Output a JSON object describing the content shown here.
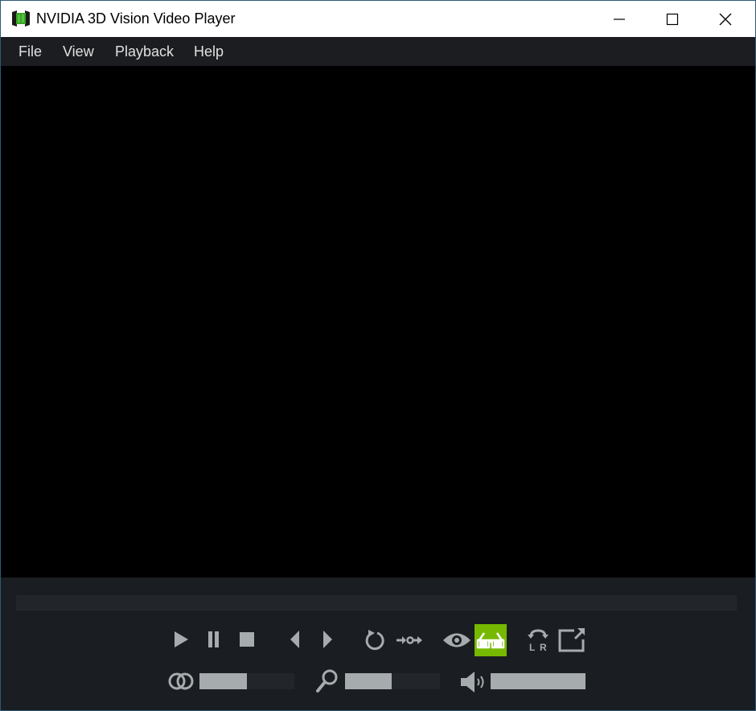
{
  "window": {
    "title": "NVIDIA 3D Vision Video Player",
    "icon": "nvidia-app-icon",
    "controls": [
      "minimize",
      "maximize",
      "close"
    ]
  },
  "menu": {
    "items": [
      {
        "label": "File"
      },
      {
        "label": "View"
      },
      {
        "label": "Playback"
      },
      {
        "label": "Help"
      }
    ]
  },
  "player": {
    "seek_progress": 0,
    "buttons": [
      {
        "name": "play",
        "icon": "play-icon"
      },
      {
        "name": "pause",
        "icon": "pause-icon"
      },
      {
        "name": "stop",
        "icon": "stop-icon"
      },
      {
        "name": "previous",
        "icon": "step-back-icon"
      },
      {
        "name": "next",
        "icon": "step-forward-icon"
      },
      {
        "name": "repeat",
        "icon": "repeat-icon"
      },
      {
        "name": "ab-loop",
        "icon": "ab-loop-icon"
      },
      {
        "name": "2d-view",
        "icon": "eye-icon"
      },
      {
        "name": "3d-view",
        "icon": "3d-glasses-icon",
        "active": true
      },
      {
        "name": "swap-eyes",
        "icon": "swap-lr-icon",
        "text_l": "L",
        "text_r": "R"
      },
      {
        "name": "fullscreen",
        "icon": "fullscreen-icon"
      }
    ],
    "sliders": {
      "depth": {
        "icon": "stereo-depth-icon",
        "value": 0.5
      },
      "zoom": {
        "icon": "magnifier-icon",
        "value": 0.49
      },
      "volume": {
        "icon": "speaker-icon",
        "value": 1.0
      }
    }
  },
  "colors": {
    "accent": "#76b900",
    "icon": "#a6abad",
    "background": "#1a1d21",
    "video": "#000000"
  }
}
